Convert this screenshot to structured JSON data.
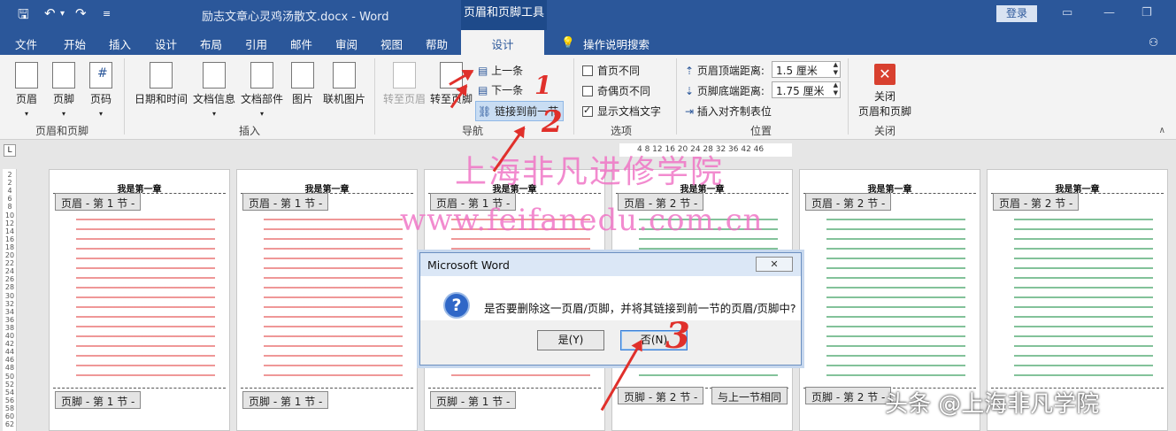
{
  "titlebar": {
    "doc_title": "励志文章心灵鸡汤散文.docx  -  Word",
    "context_tools": "页眉和页脚工具",
    "login": "登录"
  },
  "tabs": [
    "文件",
    "开始",
    "插入",
    "设计",
    "布局",
    "引用",
    "邮件",
    "审阅",
    "视图",
    "帮助"
  ],
  "active_tab": "设计",
  "tell_me": "操作说明搜索",
  "ribbon": {
    "group1": {
      "label": "页眉和页脚",
      "buttons": [
        "页眉",
        "页脚",
        "页码"
      ]
    },
    "group2": {
      "label": "插入",
      "buttons": [
        "日期和时间",
        "文档信息",
        "文档部件",
        "图片",
        "联机图片"
      ]
    },
    "group3": {
      "label": "导航",
      "goto_header": "转至页眉",
      "goto_footer": "转至页脚",
      "prev": "上一条",
      "next": "下一条",
      "link_prev": "链接到前一节"
    },
    "group4": {
      "label": "选项",
      "first_diff": "首页不同",
      "odd_even_diff": "奇偶页不同",
      "show_text": "显示文档文字"
    },
    "group5": {
      "label": "位置",
      "header_top": "页眉顶端距离:",
      "header_top_val": "1.5 厘米",
      "footer_bottom": "页脚底端距离:",
      "footer_bottom_val": "1.75 厘米",
      "insert_align_tab": "插入对齐制表位"
    },
    "group6": {
      "label": "关闭",
      "close_btn_l1": "关闭",
      "close_btn_l2": "页眉和页脚"
    }
  },
  "hruler": "4   8  12  16  20  24  28  32  36   42  46",
  "vruler": [
    "2",
    "2",
    "4",
    "6",
    "8",
    "10",
    "12",
    "14",
    "16",
    "18",
    "20",
    "22",
    "24",
    "26",
    "28",
    "30",
    "32",
    "34",
    "36",
    "38",
    "40",
    "42",
    "44",
    "46",
    "48",
    "50",
    "52",
    "54",
    "56",
    "58",
    "60",
    "62"
  ],
  "pages": [
    {
      "chapter": "我是第一章",
      "header_tag": "页眉 - 第 1 节 -",
      "footer_tag": "页脚 - 第 1 节 -",
      "body_color": "red"
    },
    {
      "chapter": "我是第一章",
      "header_tag": "页眉 - 第 1 节 -",
      "footer_tag": "页脚 - 第 1 节 -",
      "body_color": "red"
    },
    {
      "chapter": "我是第一章",
      "header_tag": "页眉 - 第 1 节 -",
      "footer_tag": "页脚 - 第 1 节 -",
      "body_color": "red"
    },
    {
      "chapter": "我是第一章",
      "header_tag": "页眉 - 第 2 节 -",
      "footer_tag": "页脚 - 第 2 节 -",
      "same_as_prev": "与上一节相同",
      "body_color": "green"
    },
    {
      "chapter": "我是第一章",
      "header_tag": "页眉 - 第 2 节 -",
      "footer_tag": "页脚 - 第 2 节 -",
      "body_color": "green"
    },
    {
      "chapter": "我是第一章",
      "header_tag": "页眉 - 第 2 节 -",
      "footer_tag": "",
      "body_color": "green"
    }
  ],
  "watermark": {
    "line1": "上海非凡进修学院",
    "line2": "www.feifanedu.com.cn"
  },
  "dialog": {
    "title": "Microsoft Word",
    "message": "是否要删除这一页眉/页脚，并将其链接到前一节的页眉/页脚中?",
    "yes": "是(Y)",
    "no": "否(N)"
  },
  "annotations": [
    "1",
    "2",
    "3"
  ],
  "credit": "头条 @上海非凡学院",
  "colors": {
    "ribbon_blue": "#2b579a",
    "annotation_red": "#e0302b",
    "watermark_pink": "#f06fc4"
  }
}
